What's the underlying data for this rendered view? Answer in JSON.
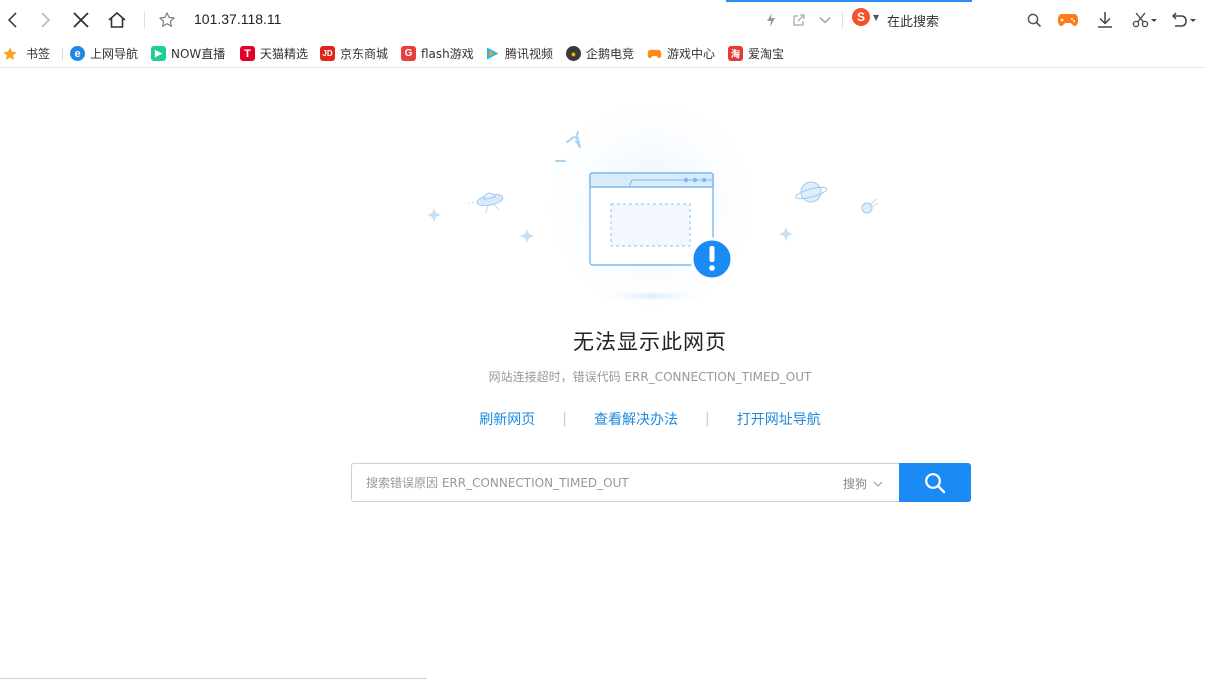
{
  "toolbar": {
    "url": "101.37.118.11",
    "search_engine_label": "在此搜索"
  },
  "bookmarks": [
    {
      "label": "书签",
      "icon": "star-icon",
      "color": "#f5a623"
    },
    {
      "label": "上网导航",
      "icon": "ie-e-icon",
      "color": "#1e88e5"
    },
    {
      "label": "NOW直播",
      "icon": "now-live-icon",
      "color": "#1fcf8f"
    },
    {
      "label": "天猫精选",
      "icon": "tmall-icon",
      "color": "#e4002b"
    },
    {
      "label": "京东商城",
      "icon": "jd-icon",
      "color": "#e1251b"
    },
    {
      "label": "flash游戏",
      "icon": "flash-game-icon",
      "color": "#e8413c"
    },
    {
      "label": "腾讯视频",
      "icon": "tencent-video-icon",
      "color": "#1eb5f0"
    },
    {
      "label": "企鹅电竞",
      "icon": "penguin-esports-icon",
      "color": "#f5b400"
    },
    {
      "label": "游戏中心",
      "icon": "game-center-icon",
      "color": "#ff8c1a"
    },
    {
      "label": "爱淘宝",
      "icon": "ai-taobao-icon",
      "color": "#e33b3b"
    }
  ],
  "error": {
    "title": "无法显示此网页",
    "detail": "网站连接超时，错误代码 ERR_CONNECTION_TIMED_OUT"
  },
  "actions": {
    "refresh": "刷新网页",
    "solutions": "查看解决办法",
    "nav": "打开网址导航"
  },
  "search": {
    "placeholder": "搜索错误原因 ERR_CONNECTION_TIMED_OUT",
    "engine": "搜狗"
  },
  "colors": {
    "accent": "#1a8af5",
    "link": "#1d8ae0",
    "warning_badge": "#1a8af5"
  }
}
